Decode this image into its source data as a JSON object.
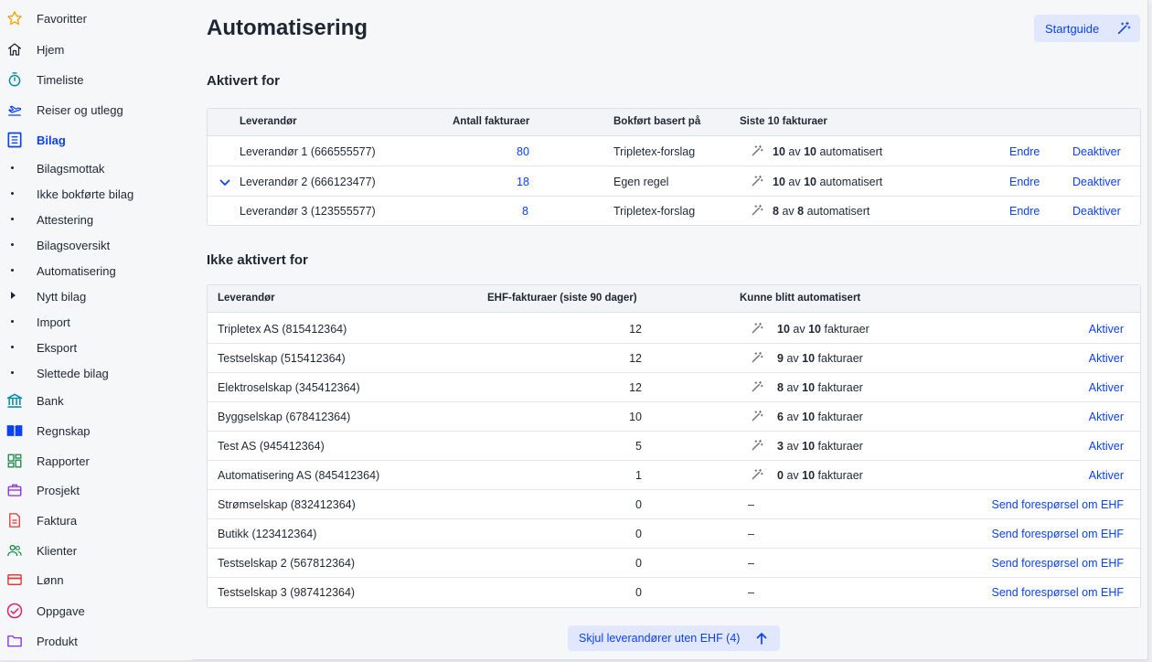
{
  "sidebar": {
    "items": [
      {
        "label": "Favoritter",
        "icon": "star-icon"
      },
      {
        "label": "Hjem",
        "icon": "home-icon"
      },
      {
        "label": "Timeliste",
        "icon": "stopwatch-icon"
      },
      {
        "label": "Reiser og utlegg",
        "icon": "plane-icon"
      },
      {
        "label": "Bilag",
        "icon": "document-icon",
        "active": true
      },
      {
        "label": "Bilagsmottak",
        "sub": true
      },
      {
        "label": "Ikke bokførte bilag",
        "sub": true
      },
      {
        "label": "Attestering",
        "sub": true
      },
      {
        "label": "Bilagsoversikt",
        "sub": true
      },
      {
        "label": "Automatisering",
        "sub": true
      },
      {
        "label": "Nytt bilag",
        "sub": true,
        "expandable": true
      },
      {
        "label": "Import",
        "sub": true
      },
      {
        "label": "Eksport",
        "sub": true
      },
      {
        "label": "Slettede bilag",
        "sub": true
      },
      {
        "label": "Bank",
        "icon": "bank-icon"
      },
      {
        "label": "Regnskap",
        "icon": "book-icon"
      },
      {
        "label": "Rapporter",
        "icon": "dashboard-icon"
      },
      {
        "label": "Prosjekt",
        "icon": "briefcase-icon"
      },
      {
        "label": "Faktura",
        "icon": "invoice-icon"
      },
      {
        "label": "Klienter",
        "icon": "users-icon"
      },
      {
        "label": "Lønn",
        "icon": "card-icon"
      },
      {
        "label": "Oppgave",
        "icon": "check-circle-icon"
      },
      {
        "label": "Produkt",
        "icon": "folder-icon"
      }
    ]
  },
  "header": {
    "title": "Automatisering",
    "startguide_label": "Startguide"
  },
  "active_section": {
    "title": "Aktivert for",
    "columns": [
      "Leverandør",
      "Antall fakturaer",
      "Bokført basert på",
      "Siste 10 fakturaer"
    ],
    "rows": [
      {
        "supplier": "Leverandør 1 (666555577)",
        "count": "80",
        "basis": "Tripletex-forslag",
        "auto_n": "10",
        "auto_of": "av",
        "auto_total": "10",
        "auto_suffix": "automatisert",
        "edit": "Endre",
        "deactivate": "Deaktiver",
        "expanded": false
      },
      {
        "supplier": "Leverandør 2 (666123477)",
        "count": "18",
        "basis": "Egen regel",
        "auto_n": "10",
        "auto_of": "av",
        "auto_total": "10",
        "auto_suffix": "automatisert",
        "edit": "Endre",
        "deactivate": "Deaktiver",
        "expanded": true
      },
      {
        "supplier": "Leverandør 3 (123555577)",
        "count": "8",
        "basis": "Tripletex-forslag",
        "auto_n": "8",
        "auto_of": "av",
        "auto_total": "8",
        "auto_suffix": "automatisert",
        "edit": "Endre",
        "deactivate": "Deaktiver",
        "expanded": false
      }
    ]
  },
  "inactive_section": {
    "title": "Ikke aktivert for",
    "columns": [
      "Leverandør",
      "EHF-fakturaer (siste 90 dager)",
      "Kunne blitt automatisert"
    ],
    "rows": [
      {
        "supplier": "Tripletex AS (815412364)",
        "ehf": "12",
        "auto_n": "10",
        "auto_of": "av",
        "auto_total": "10",
        "auto_suffix": "fakturaer",
        "action": "Aktiver"
      },
      {
        "supplier": "Testselskap (515412364)",
        "ehf": "12",
        "auto_n": "9",
        "auto_of": "av",
        "auto_total": "10",
        "auto_suffix": "fakturaer",
        "action": "Aktiver"
      },
      {
        "supplier": "Elektroselskap (345412364)",
        "ehf": "12",
        "auto_n": "8",
        "auto_of": "av",
        "auto_total": "10",
        "auto_suffix": "fakturaer",
        "action": "Aktiver"
      },
      {
        "supplier": "Byggselskap (678412364)",
        "ehf": "10",
        "auto_n": "6",
        "auto_of": "av",
        "auto_total": "10",
        "auto_suffix": "fakturaer",
        "action": "Aktiver"
      },
      {
        "supplier": "Test AS (945412364)",
        "ehf": "5",
        "auto_n": "3",
        "auto_of": "av",
        "auto_total": "10",
        "auto_suffix": "fakturaer",
        "action": "Aktiver"
      },
      {
        "supplier": "Automatisering AS (845412364)",
        "ehf": "1",
        "auto_n": "0",
        "auto_of": "av",
        "auto_total": "10",
        "auto_suffix": "fakturaer",
        "action": "Aktiver"
      },
      {
        "supplier": "Strømselskap (832412364)",
        "ehf": "0",
        "dash": "–",
        "action": "Send forespørsel om EHF"
      },
      {
        "supplier": "Butikk (123412364)",
        "ehf": "0",
        "dash": "–",
        "action": "Send forespørsel om EHF"
      },
      {
        "supplier": "Testselskap 2 (567812364)",
        "ehf": "0",
        "dash": "–",
        "action": "Send forespørsel om EHF"
      },
      {
        "supplier": "Testselskap 3 (987412364)",
        "ehf": "0",
        "dash": "–",
        "action": "Send forespørsel om EHF"
      }
    ]
  },
  "footer": {
    "hide_label": "Skjul leverandører uten EHF (4)"
  },
  "colors": {
    "accent": "#0a41fa",
    "accent_bg": "#e1e8fd",
    "text": "#1f2633"
  }
}
